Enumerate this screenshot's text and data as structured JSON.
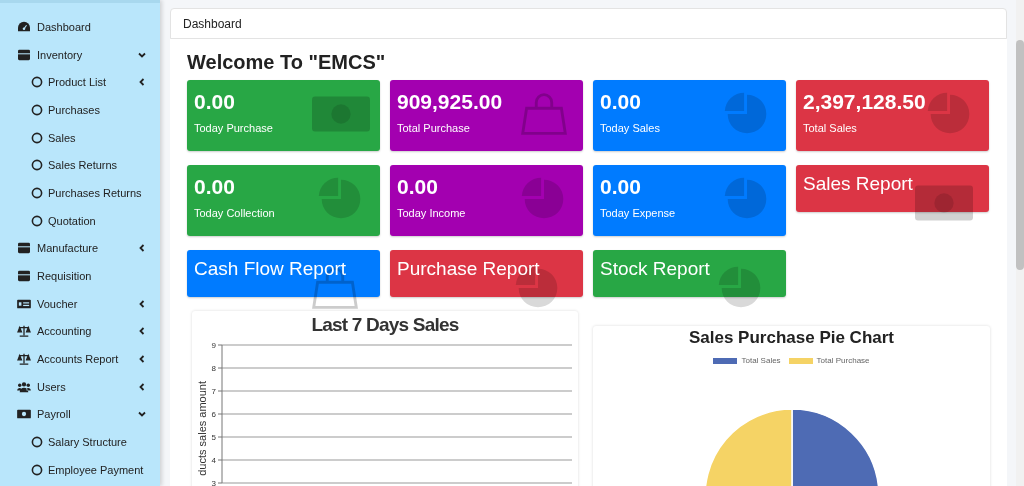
{
  "sidebar": {
    "items": [
      {
        "label": "Dashboard",
        "kind": "link"
      },
      {
        "label": "Inventory",
        "kind": "menu",
        "expanded": true,
        "children": [
          {
            "label": "Product List",
            "kind": "menu",
            "expanded": false
          },
          {
            "label": "Purchases",
            "kind": "link"
          },
          {
            "label": "Sales",
            "kind": "link"
          },
          {
            "label": "Sales Returns",
            "kind": "link"
          },
          {
            "label": "Purchases Returns",
            "kind": "link"
          },
          {
            "label": "Quotation",
            "kind": "link"
          }
        ]
      },
      {
        "label": "Manufacture",
        "kind": "menu",
        "expanded": false
      },
      {
        "label": "Requisition",
        "kind": "link"
      },
      {
        "label": "Voucher",
        "kind": "menu",
        "expanded": false
      },
      {
        "label": "Accounting",
        "kind": "menu",
        "expanded": false
      },
      {
        "label": "Accounts Report",
        "kind": "menu",
        "expanded": false
      },
      {
        "label": "Users",
        "kind": "menu",
        "expanded": false
      },
      {
        "label": "Payroll",
        "kind": "menu",
        "expanded": true,
        "children": [
          {
            "label": "Salary Structure",
            "kind": "link"
          },
          {
            "label": "Employee Payment",
            "kind": "link"
          }
        ]
      }
    ]
  },
  "breadcrumb": "Dashboard",
  "welcome": "Welcome To \"EMCS\"",
  "tiles": [
    {
      "kind": "stat",
      "value": "0.00",
      "label": "Today Purchase",
      "color": "#28a745"
    },
    {
      "kind": "stat",
      "value": "909,925.00",
      "label": "Total Purchase",
      "color": "#a300b0"
    },
    {
      "kind": "stat",
      "value": "0.00",
      "label": "Today Sales",
      "color": "#007bff"
    },
    {
      "kind": "stat",
      "value": "2,397,128.50",
      "label": "Total Sales",
      "color": "#dc3545"
    },
    {
      "kind": "stat",
      "value": "0.00",
      "label": "Today Collection",
      "color": "#28a745"
    },
    {
      "kind": "stat",
      "value": "0.00",
      "label": "Today Income",
      "color": "#a300b0"
    },
    {
      "kind": "stat",
      "value": "0.00",
      "label": "Today Expense",
      "color": "#007bff"
    },
    {
      "kind": "report",
      "label": "Sales Report",
      "color": "#dc3545"
    },
    {
      "kind": "report",
      "label": "Cash Flow Report",
      "color": "#007bff"
    },
    {
      "kind": "report",
      "label": "Purchase Report",
      "color": "#dc3545"
    },
    {
      "kind": "report",
      "label": "Stock Report",
      "color": "#28a745"
    }
  ],
  "line_chart": {
    "chart_data": {
      "type": "line",
      "title": "Last 7 Days Sales",
      "ylabel": "ducts sales amount",
      "categories": [
        null,
        null,
        null,
        null,
        null,
        null,
        null
      ],
      "ylim": [
        3,
        9
      ],
      "yticks": [
        3,
        4,
        5,
        6,
        7,
        8,
        9
      ],
      "grid": true
    }
  },
  "pie_chart": {
    "chart_data": {
      "type": "pie",
      "title": "Sales Purchase Pie Chart",
      "categories": [
        "Total Sales",
        "Total Purchase"
      ],
      "values": [
        72.49,
        27.51
      ],
      "legend": "top"
    },
    "slices": [
      {
        "color": "#4e6bb4"
      },
      {
        "color": "#f5d365"
      }
    ]
  }
}
